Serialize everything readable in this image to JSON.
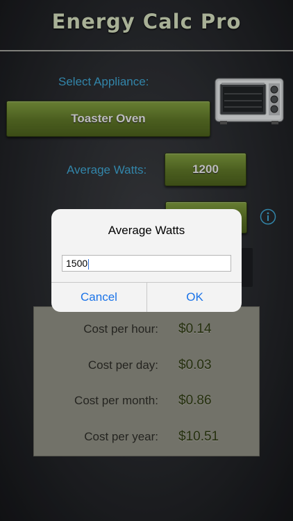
{
  "app": {
    "title": "Energy Calc Pro"
  },
  "main": {
    "select_label": "Select Appliance:",
    "appliance_name": "Toaster Oven",
    "watts_label": "Average Watts:",
    "watts_value": "1200",
    "appliance_icon": "toaster-oven-image",
    "info_icon": "info-icon"
  },
  "results": {
    "rows": [
      {
        "label": "Cost per hour:",
        "value": "$0.14"
      },
      {
        "label": "Cost per day:",
        "value": "$0.03"
      },
      {
        "label": "Cost per month:",
        "value": "$0.86"
      },
      {
        "label": "Cost per year:",
        "value": "$10.51"
      }
    ]
  },
  "dialog": {
    "title": "Average Watts",
    "input_value": "1500",
    "cancel_label": "Cancel",
    "ok_label": "OK"
  },
  "colors": {
    "accent_blue": "#3ea3cf",
    "button_green": "#5b7226",
    "panel_gray": "#8c8b80",
    "ios_blue": "#1a73e8"
  }
}
